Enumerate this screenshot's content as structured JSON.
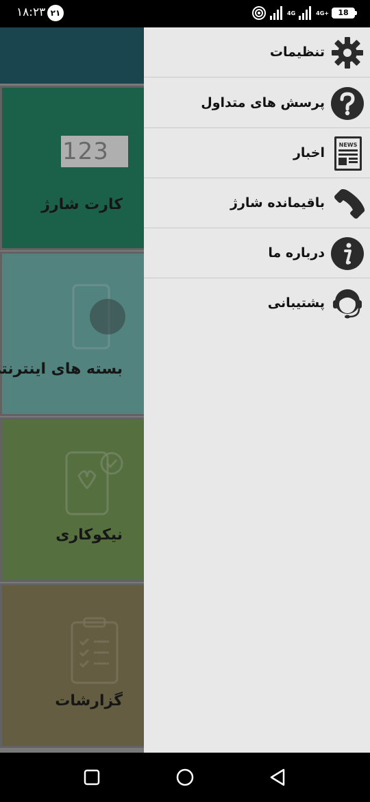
{
  "status_bar": {
    "time": "۱۸:۲۳",
    "notification_badge": "۲۱",
    "network_1": "4G",
    "network_2": "4G+",
    "battery": "18"
  },
  "background_tiles": [
    {
      "label": "کارت شارژ",
      "card_text": "123",
      "color": "#1f6f55"
    },
    {
      "label": "بسته های اینترنتی",
      "color": "#5f9691"
    },
    {
      "label": "نیکوکاری",
      "color": "#617f47"
    },
    {
      "label": "گزارشات",
      "color": "#736a4c"
    }
  ],
  "drawer": {
    "items": [
      {
        "label": "تنظیمات",
        "icon": "gear-icon"
      },
      {
        "label": "پرسش های متداول",
        "icon": "question-icon"
      },
      {
        "label": "اخبار",
        "icon": "news-icon",
        "icon_text": "NEWS"
      },
      {
        "label": "باقیمانده شارژ",
        "icon": "phone-icon"
      },
      {
        "label": "درباره ما",
        "icon": "info-icon"
      },
      {
        "label": "پشتیبانی",
        "icon": "support-icon"
      }
    ]
  },
  "colors": {
    "header": "#1f4f59",
    "drawer_bg": "#e8e8e8",
    "icon_dark": "#2b2b2b"
  }
}
